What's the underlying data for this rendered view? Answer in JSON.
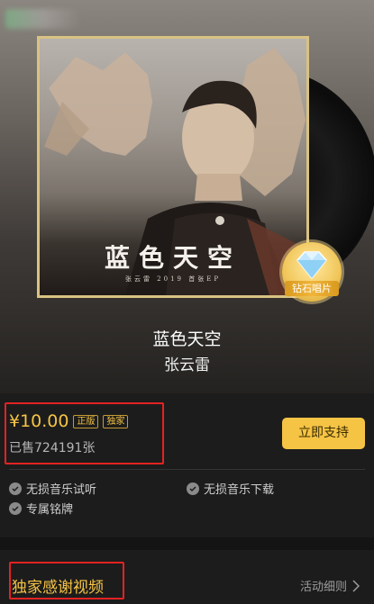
{
  "album": {
    "cover_title": "蓝色天空",
    "cover_subtitle": "张云雷 2019 首张EP",
    "badge_label": "钻石唱片",
    "title": "蓝色天空",
    "artist": "张云雷"
  },
  "purchase": {
    "price": "¥10.00",
    "tags": [
      "正版",
      "独家"
    ],
    "sold": "已售724191张",
    "support_button": "立即支持"
  },
  "benefits": [
    "无损音乐试听",
    "无损音乐下载",
    "专属铭牌"
  ],
  "thanks": {
    "title": "独家感谢视频",
    "rules_link": "活动细则"
  },
  "colors": {
    "accent": "#f6c445",
    "highlight": "#e32222",
    "background": "#1c1c1c"
  }
}
